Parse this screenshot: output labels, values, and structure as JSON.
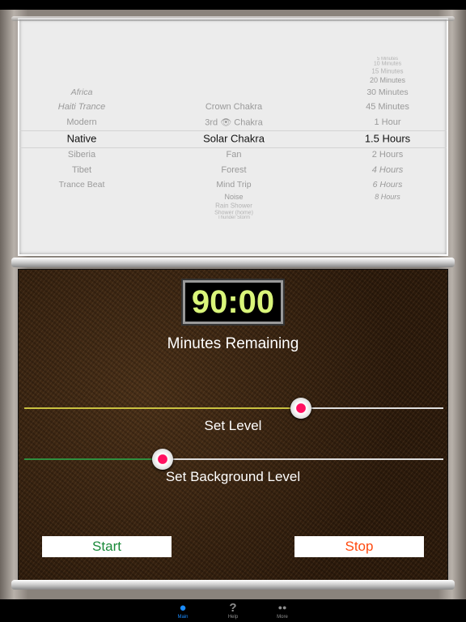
{
  "picker": {
    "columns": [
      {
        "name": "rhythm",
        "selected": 3,
        "items": [
          {
            "t": "Africa",
            "i": true
          },
          {
            "t": "Haiti Trance",
            "i": true
          },
          {
            "t": "Modern"
          },
          {
            "t": "Native"
          },
          {
            "t": "Siberia"
          },
          {
            "t": "Tibet"
          },
          {
            "t": "Trance Beat"
          }
        ]
      },
      {
        "name": "background",
        "selected": 2,
        "items": [
          {
            "t": "Crown Chakra"
          },
          {
            "t": "3rd 👁 Chakra"
          },
          {
            "t": "Solar Chakra"
          },
          {
            "t": "Fan"
          },
          {
            "t": "Forest"
          },
          {
            "t": "Mind Trip"
          },
          {
            "t": "Noise"
          },
          {
            "t": "Rain Shower"
          },
          {
            "t": "Shower (home)"
          },
          {
            "t": "Thunder Storm"
          }
        ]
      },
      {
        "name": "duration",
        "selected": 7,
        "items": [
          {
            "t": "5 Minutes"
          },
          {
            "t": "10 Minutes"
          },
          {
            "t": "15 Minutes"
          },
          {
            "t": "20 Minutes"
          },
          {
            "t": "30 Minutes"
          },
          {
            "t": "45 Minutes"
          },
          {
            "t": "1 Hour"
          },
          {
            "t": "1.5 Hours"
          },
          {
            "t": "2 Hours"
          },
          {
            "t": "4 Hours",
            "i": true
          },
          {
            "t": "6 Hours",
            "i": true
          },
          {
            "t": "8 Hours",
            "i": true
          }
        ]
      }
    ]
  },
  "timer": {
    "value": "90:00",
    "label": "Minutes Remaining",
    "color": "#d9f57a"
  },
  "level": {
    "label": "Set Level",
    "value": 0.66,
    "color": "#c8c040"
  },
  "background_level": {
    "label": "Set Background Level",
    "value": 0.33,
    "color": "#2f8f3f"
  },
  "buttons": {
    "start": "Start",
    "stop": "Stop",
    "start_color": "#1a8a3a",
    "stop_color": "#ff4a10"
  },
  "tabs": [
    {
      "label": "Main",
      "icon": "meditator-icon",
      "active": true
    },
    {
      "label": "Help",
      "icon": "question-icon"
    },
    {
      "label": "More",
      "icon": "glasses-icon"
    }
  ]
}
